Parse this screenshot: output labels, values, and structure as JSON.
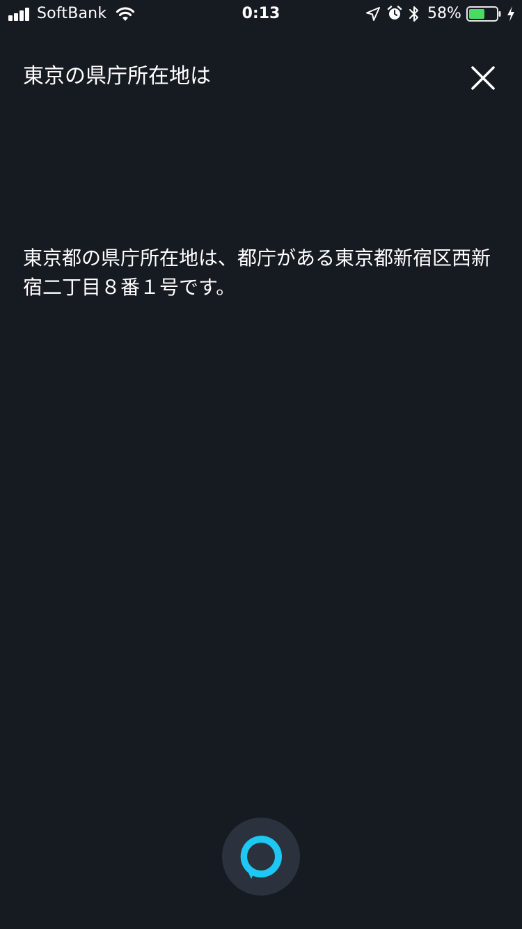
{
  "status_bar": {
    "carrier": "SoftBank",
    "time": "0:13",
    "battery_percent": "58%",
    "battery_level": 0.58,
    "icons": [
      "signal-icon",
      "wifi-icon",
      "location-icon",
      "alarm-icon",
      "bluetooth-icon",
      "battery-icon",
      "charging-icon"
    ]
  },
  "header": {
    "query": "東京の県庁所在地は",
    "close_icon": "close-icon"
  },
  "answer": {
    "text": "東京都の県庁所在地は、都庁がある東京都新宿区西新宿二丁目８番１号です。"
  },
  "alexa_button": {
    "icon": "alexa-ring-icon",
    "accent_color": "#1ec8f4"
  },
  "colors": {
    "background": "#161a21",
    "button_background": "#2b323d",
    "battery_fill": "#4cd964",
    "text": "#ffffff"
  }
}
